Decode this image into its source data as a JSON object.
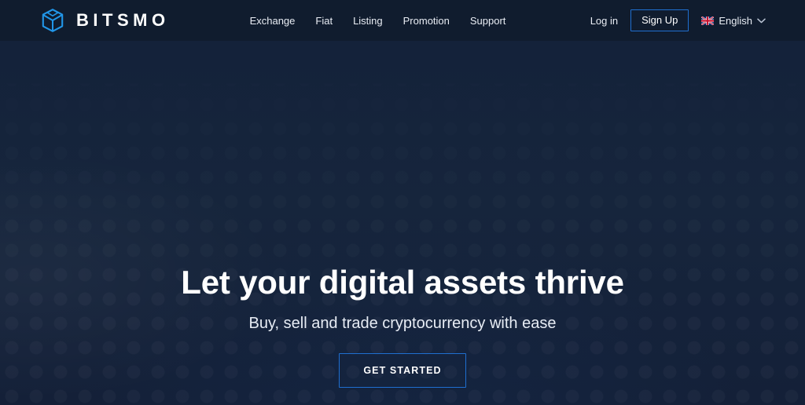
{
  "header": {
    "brand": {
      "name": "BITSMO",
      "icon": "cube-logo-icon",
      "icon_color": "#2196e8"
    },
    "nav": [
      {
        "label": "Exchange"
      },
      {
        "label": "Fiat"
      },
      {
        "label": "Listing"
      },
      {
        "label": "Promotion"
      },
      {
        "label": "Support"
      }
    ],
    "login_label": "Log in",
    "signup_label": "Sign Up",
    "language": {
      "label": "English",
      "flag_icon": "uk-flag-icon",
      "chevron_icon": "chevron-down-icon"
    },
    "background_color": "#101c2e",
    "accent_color": "#1f6fd0"
  },
  "hero": {
    "title": "Let your digital assets thrive",
    "subtitle": "Buy, sell and trade cryptocurrency with ease",
    "cta_label": "GET STARTED",
    "background_color": "#16253c",
    "accent_color": "#1f6fd0"
  }
}
